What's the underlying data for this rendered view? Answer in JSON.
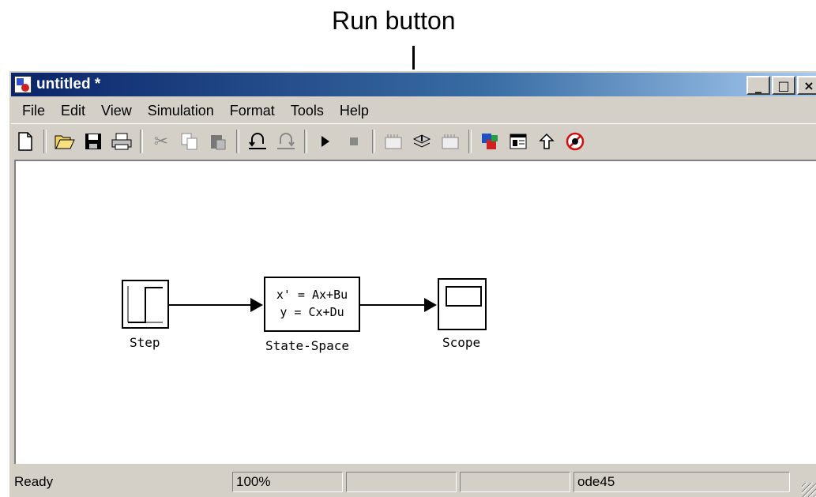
{
  "annotation": {
    "text": "Run button"
  },
  "window": {
    "title": "untitled *",
    "controls": {
      "minimize": "_",
      "maximize": "□",
      "close": "×"
    }
  },
  "menu": [
    {
      "label": "File"
    },
    {
      "label": "Edit"
    },
    {
      "label": "View"
    },
    {
      "label": "Simulation"
    },
    {
      "label": "Format"
    },
    {
      "label": "Tools"
    },
    {
      "label": "Help"
    }
  ],
  "toolbar": {
    "icons": [
      "new-model-icon",
      "open-icon",
      "save-icon",
      "print-icon",
      "cut-icon",
      "copy-icon",
      "paste-icon",
      "undo-icon",
      "redo-icon",
      "run-icon",
      "stop-icon",
      "build-icon",
      "update-diagram-icon",
      "build-subsystem-icon",
      "library-browser-icon",
      "model-explorer-icon",
      "go-to-parent-icon",
      "debug-icon"
    ]
  },
  "diagram": {
    "blocks": [
      {
        "id": "step",
        "label": "Step"
      },
      {
        "id": "state-space",
        "label": "State-Space",
        "line1": "x' = Ax+Bu",
        "line2": "y = Cx+Du"
      },
      {
        "id": "scope",
        "label": "Scope"
      }
    ]
  },
  "status": {
    "state": "Ready",
    "zoom": "100%",
    "field3": "",
    "field4": "",
    "solver": "ode45"
  }
}
